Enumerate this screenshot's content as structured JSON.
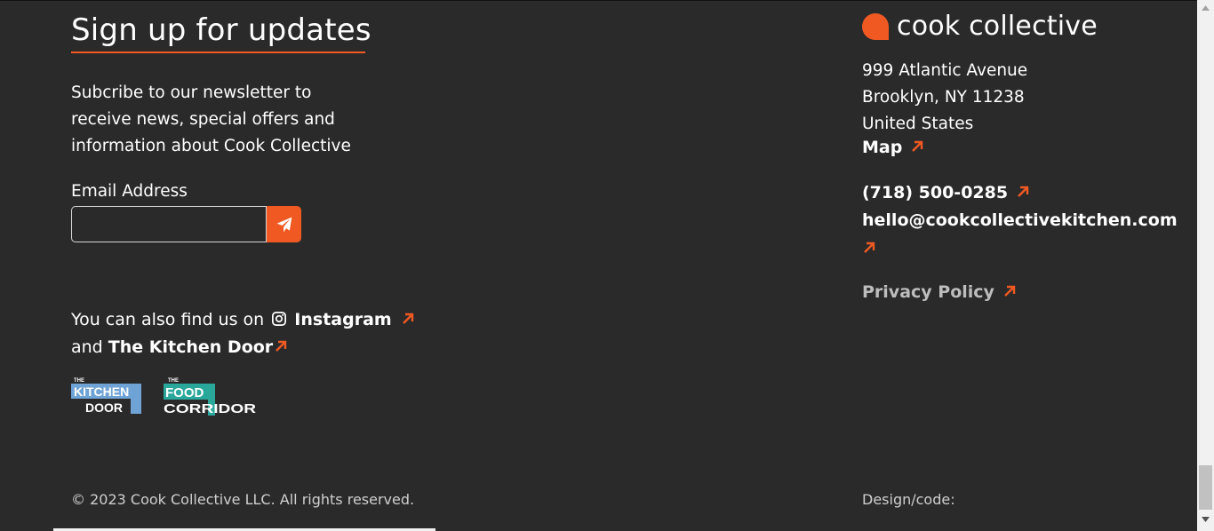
{
  "newsletter": {
    "heading": "Sign up for updates",
    "blurb": "Subcribe to our newsletter to receive news, special offers and information about Cook Collective",
    "email_label": "Email Address",
    "email_placeholder": "",
    "email_value": ""
  },
  "social": {
    "prefix": "You can also find us on",
    "instagram_label": "Instagram",
    "and_text": "and",
    "kitchen_door_label": "The Kitchen Door"
  },
  "partner_logos": {
    "kitchen_door": {
      "the": "THE",
      "line1": "KITCHEN",
      "line2": "DOOR"
    },
    "food_corridor": {
      "the": "THE",
      "line1": "FOOD",
      "line2": "CORRIDOR"
    }
  },
  "brand": {
    "name": "cook collective"
  },
  "address": {
    "line1": "999 Atlantic Avenue",
    "line2": "Brooklyn, NY 11238",
    "line3": "United States",
    "map_label": "Map"
  },
  "contact": {
    "phone": "(718) 500-0285",
    "email": "hello@cookcollectivekitchen.com"
  },
  "legal": {
    "privacy_label": "Privacy Policy",
    "copyright": "© 2023 Cook Collective LLC. All rights reserved.",
    "design_label": "Design/code:"
  },
  "colors": {
    "background": "#2b2a2a",
    "accent": "#f05a22",
    "kitchen_door_blue": "#6fa3d6",
    "food_corridor_teal": "#2aa79b"
  },
  "icons": [
    "send-icon",
    "instagram-icon",
    "external-link-arrow-icon",
    "brand-speech-bubble-icon"
  ]
}
